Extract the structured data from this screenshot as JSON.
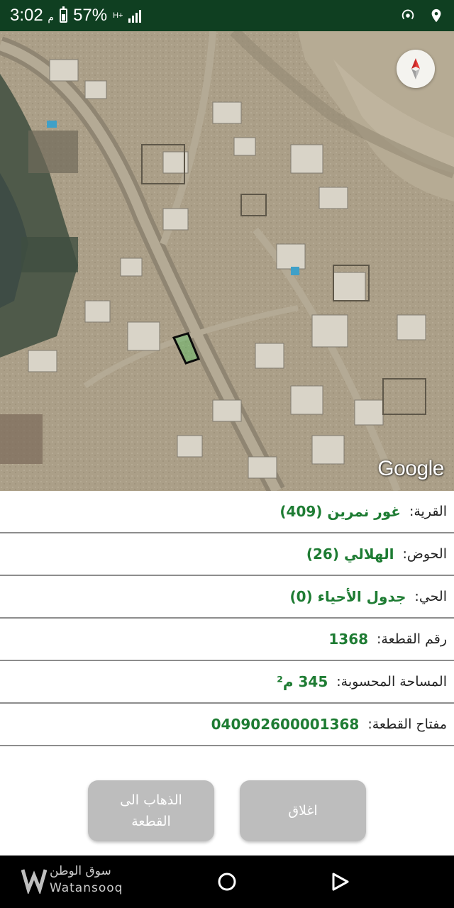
{
  "status_bar": {
    "time": "3:02",
    "time_suffix": "م",
    "battery": "57%",
    "network_type": "H+",
    "icons": [
      "battery-icon",
      "signal-icon",
      "hotspot-icon",
      "location-icon"
    ]
  },
  "map": {
    "attribution": "Google",
    "compass_icon": "compass-icon"
  },
  "info": [
    {
      "label": "القرية:",
      "value": "غور نمرين (409)"
    },
    {
      "label": "الحوض:",
      "value": "الهلالي (26)"
    },
    {
      "label": "الحي:",
      "value": "جدول الأحياء (0)"
    },
    {
      "label": "رقم القطعة:",
      "value": "1368"
    },
    {
      "label": "المساحة المحسوبة:",
      "value": "345 م²"
    },
    {
      "label": "مفتاح القطعة:",
      "value": "040902600001368"
    }
  ],
  "buttons": {
    "goto_line1": "الذهاب الى",
    "goto_line2": "القطعة",
    "close": "اغلاق"
  },
  "watermark": {
    "arabic": "سوق الوطن",
    "english": "Watansooq"
  },
  "colors": {
    "status_bar": "#0f3f21",
    "value_green": "#1e7c33",
    "button_gray": "#bdbdbd"
  }
}
